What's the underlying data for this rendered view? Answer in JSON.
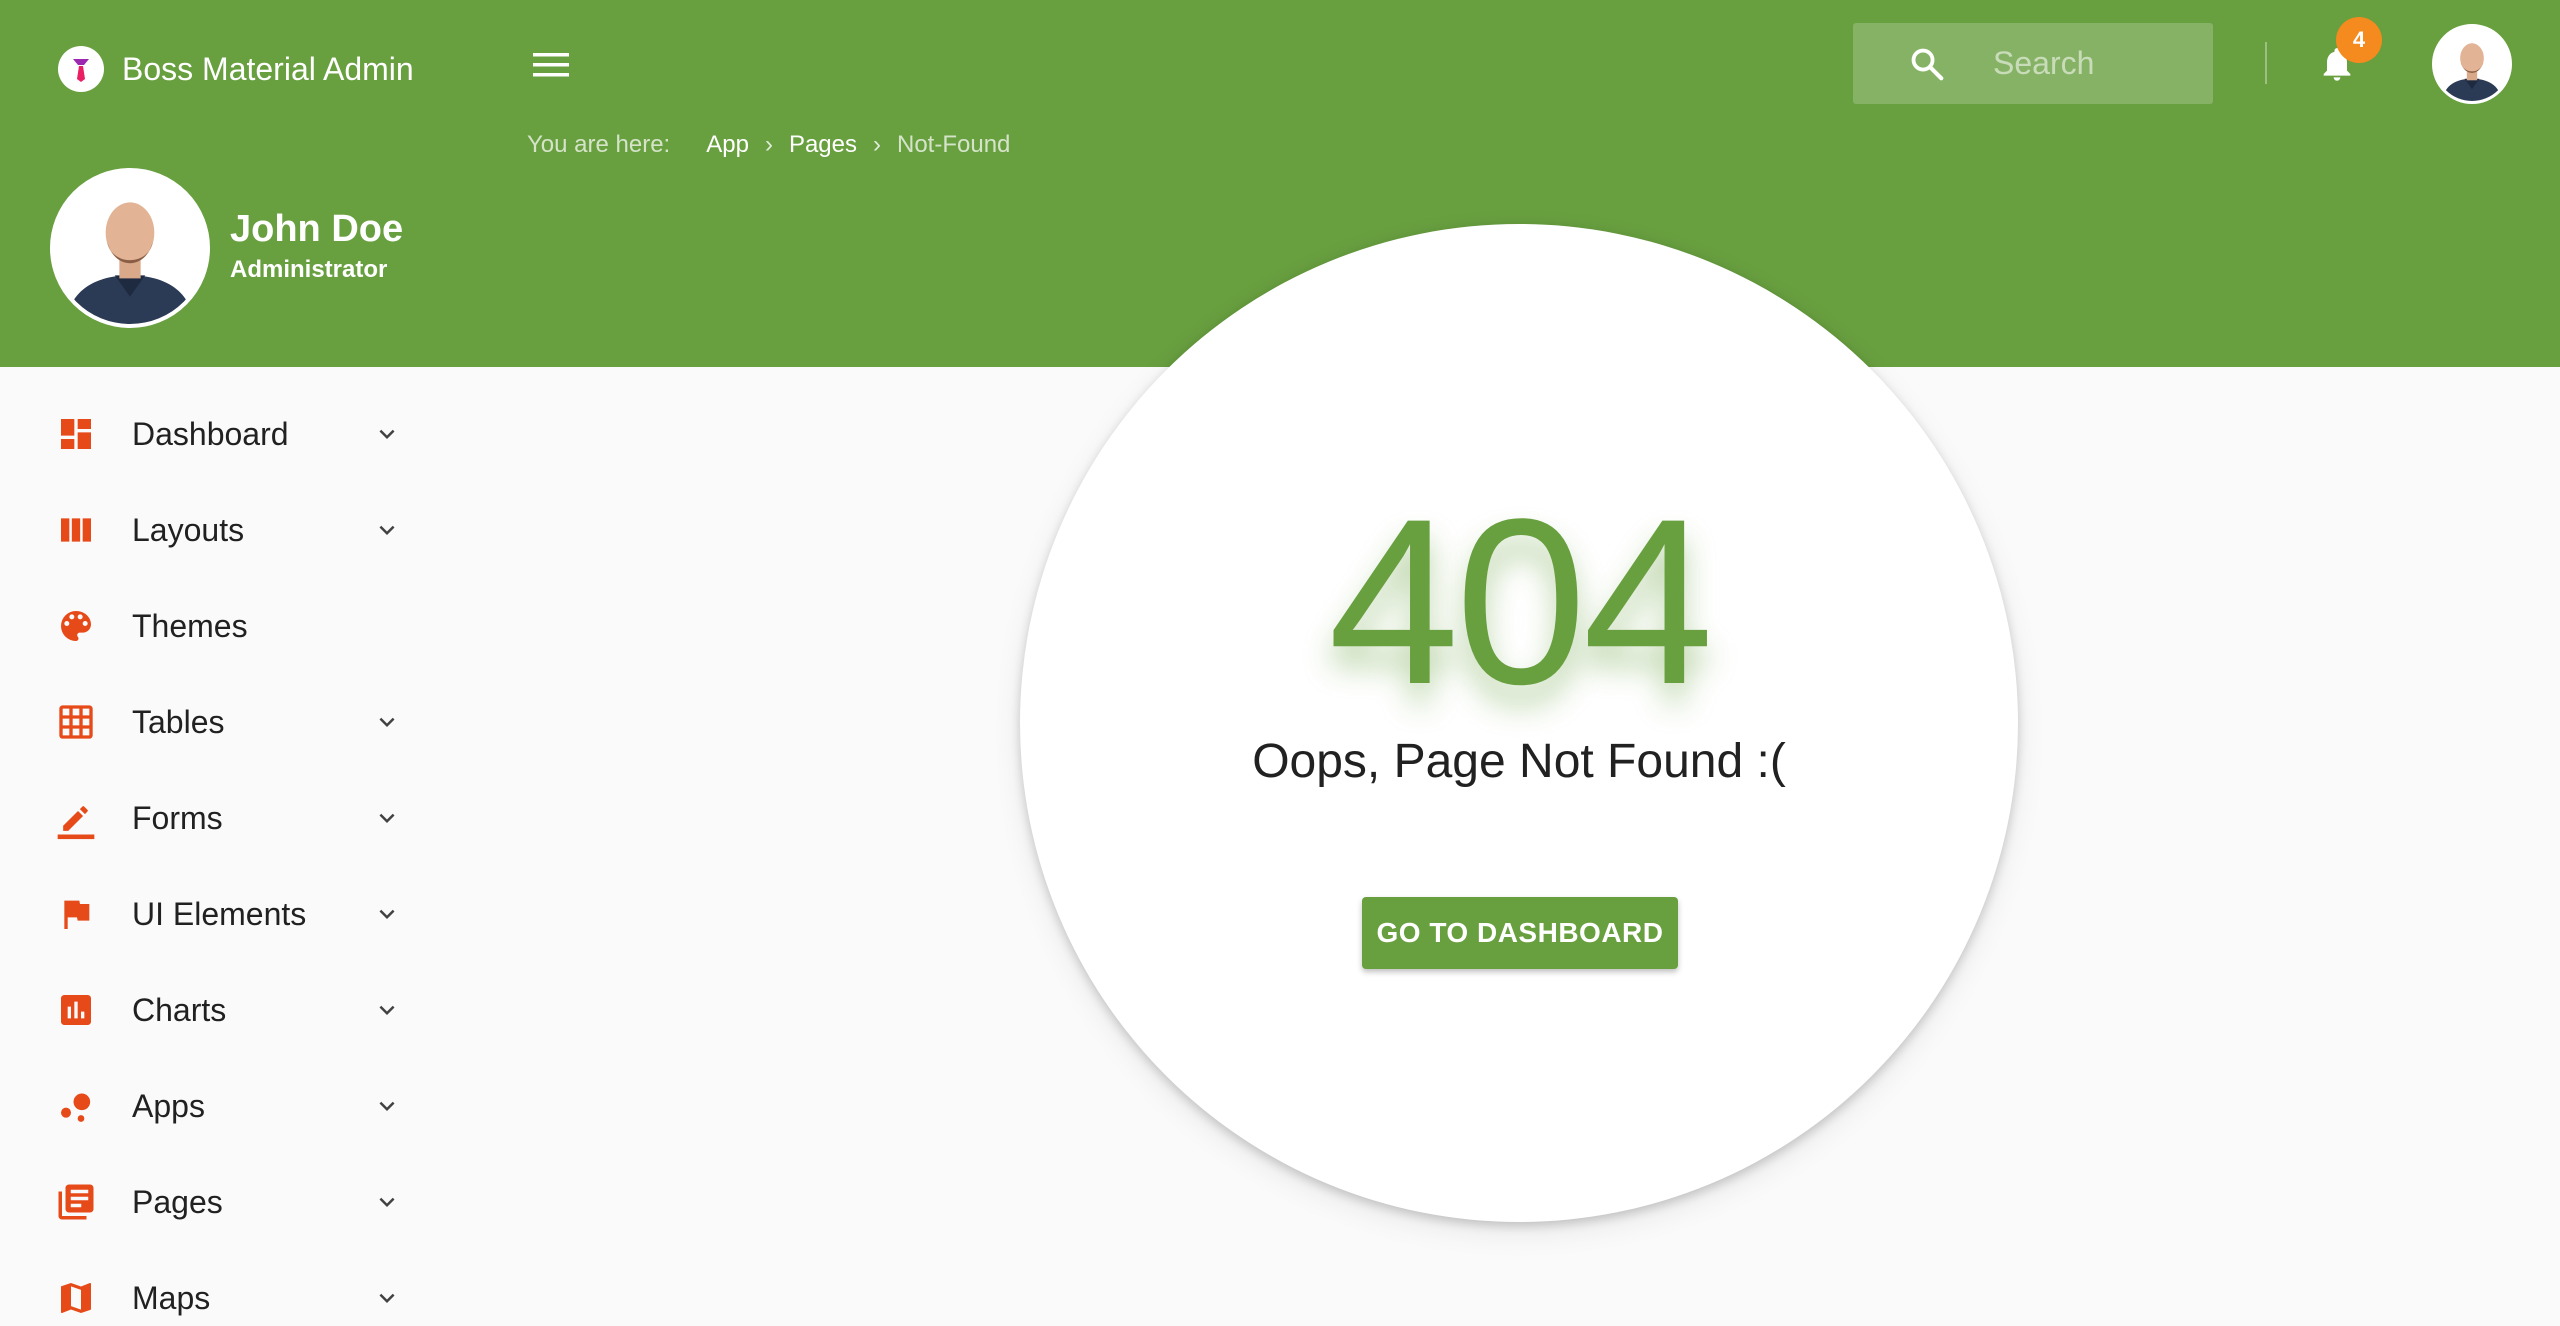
{
  "brand": {
    "name": "Boss Material Admin",
    "logo_icon": "tie-logo-icon"
  },
  "header": {
    "menu_icon": "menu-icon",
    "search": {
      "placeholder": "Search",
      "value": ""
    },
    "notifications": {
      "count": "4"
    }
  },
  "breadcrumb": {
    "lead": "You are here:",
    "items": [
      "App",
      "Pages",
      "Not-Found"
    ],
    "separator": "›"
  },
  "profile": {
    "name": "John Doe",
    "role": "Administrator"
  },
  "sidebar": {
    "items": [
      {
        "label": "Dashboard",
        "icon": "dashboard-icon",
        "expandable": true
      },
      {
        "label": "Layouts",
        "icon": "view-week-icon",
        "expandable": true
      },
      {
        "label": "Themes",
        "icon": "palette-icon",
        "expandable": false
      },
      {
        "label": "Tables",
        "icon": "grid-icon",
        "expandable": true
      },
      {
        "label": "Forms",
        "icon": "edit-pencil-icon",
        "expandable": true
      },
      {
        "label": "UI Elements",
        "icon": "flag-icon",
        "expandable": true
      },
      {
        "label": "Charts",
        "icon": "bar-chart-icon",
        "expandable": true
      },
      {
        "label": "Apps",
        "icon": "bubbles-icon",
        "expandable": true
      },
      {
        "label": "Pages",
        "icon": "library-books-icon",
        "expandable": true
      },
      {
        "label": "Maps",
        "icon": "map-icon",
        "expandable": true
      }
    ]
  },
  "error": {
    "code": "404",
    "message": "Oops, Page Not Found :(",
    "button_label": "GO TO DASHBOARD"
  },
  "colors": {
    "primary": "#689f3f",
    "accent": "#e64a19",
    "badge": "#f58a1f",
    "background": "#fafafa"
  }
}
